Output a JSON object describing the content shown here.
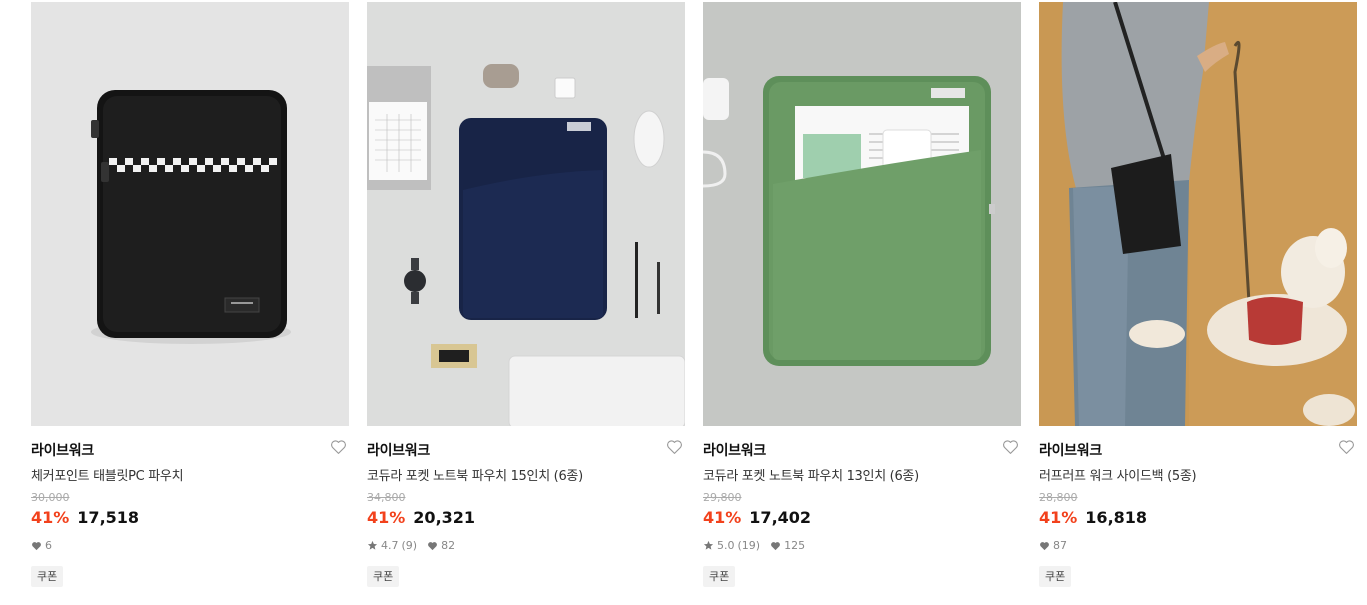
{
  "products": [
    {
      "brand": "라이브워크",
      "title": "체커포인트 태블릿PC 파우치",
      "original_price": "30,000",
      "discount": "41%",
      "price": "17,518",
      "rating": "",
      "reviews": "",
      "likes": "6",
      "badge": "쿠폰",
      "image_icon": "black-tablet-pouch-image"
    },
    {
      "brand": "라이브워크",
      "title": "코듀라 포켓 노트북 파우치 15인치 (6종)",
      "original_price": "34,800",
      "discount": "41%",
      "price": "20,321",
      "rating": "4.7",
      "reviews": "(9)",
      "likes": "82",
      "badge": "쿠폰",
      "image_icon": "navy-laptop-pouch-image"
    },
    {
      "brand": "라이브워크",
      "title": "코듀라 포켓 노트북 파우치 13인치 (6종)",
      "original_price": "29,800",
      "discount": "41%",
      "price": "17,402",
      "rating": "5.0",
      "reviews": "(19)",
      "likes": "125",
      "badge": "쿠폰",
      "image_icon": "green-laptop-pouch-image"
    },
    {
      "brand": "라이브워크",
      "title": "러프러프 워크 사이드백 (5종)",
      "original_price": "28,800",
      "discount": "41%",
      "price": "16,818",
      "rating": "",
      "reviews": "",
      "likes": "87",
      "badge": "쿠폰",
      "image_icon": "side-bag-dog-image"
    }
  ],
  "colors": {
    "discount": "#f2411c",
    "strike": "#aaaaaa",
    "badge_bg": "#f2f2f2"
  }
}
